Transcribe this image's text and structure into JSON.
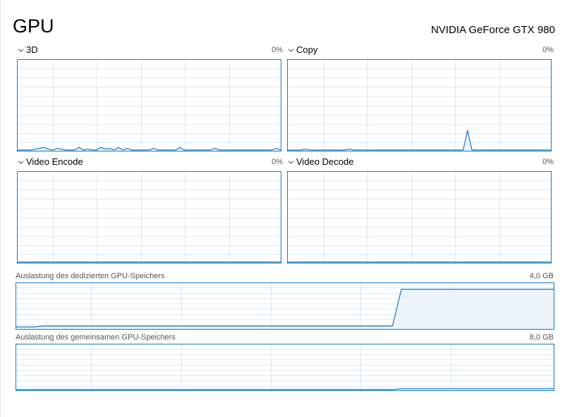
{
  "title": "GPU",
  "gpu_name": "NVIDIA GeForce GTX 980",
  "colors": {
    "graph_border": "#1779ba",
    "graph_line": "#1779ba",
    "grid": "#d9eaf7",
    "fill": "#e8f1fa"
  },
  "engines": [
    {
      "label": "3D",
      "utilization": "0%",
      "expand_icon": "chevron-down-icon",
      "samples": [
        0,
        0,
        0,
        0,
        0.01,
        0.02,
        0.03,
        0.01,
        0,
        0.02,
        0.01,
        0,
        0,
        0,
        0.03,
        0,
        0.01,
        0,
        0,
        0.03,
        0.01,
        0.02,
        0,
        0.03,
        0,
        0.02,
        0,
        0,
        0,
        0,
        0,
        0.02,
        0,
        0,
        0,
        0,
        0,
        0.03,
        0,
        0,
        0,
        0,
        0,
        0,
        0,
        0.02,
        0,
        0,
        0,
        0,
        0,
        0,
        0,
        0,
        0,
        0,
        0,
        0,
        0,
        0.02,
        0
      ]
    },
    {
      "label": "Copy",
      "utilization": "0%",
      "expand_icon": "chevron-down-icon",
      "samples": [
        0,
        0,
        0,
        0,
        0.01,
        0,
        0,
        0,
        0,
        0,
        0,
        0,
        0,
        0,
        0.01,
        0,
        0,
        0,
        0,
        0,
        0,
        0,
        0,
        0,
        0,
        0,
        0,
        0,
        0,
        0,
        0,
        0,
        0,
        0,
        0,
        0,
        0,
        0,
        0,
        0,
        0,
        0.22,
        0,
        0,
        0,
        0,
        0,
        0,
        0,
        0,
        0,
        0,
        0,
        0,
        0,
        0,
        0,
        0,
        0,
        0,
        0
      ]
    },
    {
      "label": "Video Encode",
      "utilization": "0%",
      "expand_icon": "chevron-down-icon",
      "samples": [
        0,
        0,
        0,
        0,
        0,
        0,
        0,
        0,
        0,
        0,
        0,
        0,
        0,
        0,
        0,
        0,
        0,
        0,
        0,
        0,
        0,
        0,
        0,
        0,
        0,
        0,
        0,
        0,
        0,
        0,
        0,
        0,
        0,
        0,
        0,
        0,
        0,
        0,
        0,
        0,
        0,
        0,
        0,
        0,
        0,
        0,
        0,
        0,
        0,
        0,
        0,
        0,
        0,
        0,
        0,
        0,
        0,
        0,
        0,
        0,
        0
      ]
    },
    {
      "label": "Video Decode",
      "utilization": "0%",
      "expand_icon": "chevron-down-icon",
      "samples": [
        0,
        0,
        0,
        0,
        0,
        0,
        0,
        0,
        0,
        0,
        0,
        0,
        0,
        0,
        0,
        0,
        0,
        0,
        0,
        0,
        0,
        0,
        0,
        0,
        0,
        0,
        0,
        0,
        0,
        0,
        0,
        0,
        0,
        0,
        0,
        0,
        0,
        0,
        0,
        0,
        0,
        0,
        0,
        0,
        0,
        0,
        0,
        0,
        0,
        0,
        0,
        0,
        0,
        0,
        0,
        0,
        0,
        0,
        0,
        0,
        0
      ]
    }
  ],
  "memory": [
    {
      "label": "Auslastung des dedizierten GPU-Speichers",
      "capacity": "4,0 GB",
      "samples": [
        0.03,
        0.03,
        0.03,
        0.05,
        0.05,
        0.05,
        0.05,
        0.05,
        0.05,
        0.05,
        0.05,
        0.05,
        0.05,
        0.05,
        0.05,
        0.05,
        0.05,
        0.05,
        0.05,
        0.05,
        0.05,
        0.05,
        0.05,
        0.05,
        0.05,
        0.05,
        0.05,
        0.05,
        0.05,
        0.05,
        0.05,
        0.05,
        0.05,
        0.05,
        0.05,
        0.05,
        0.05,
        0.05,
        0.05,
        0.05,
        0.05,
        0.05,
        0.05,
        0.88,
        0.88,
        0.88,
        0.88,
        0.88,
        0.88,
        0.88,
        0.88,
        0.88,
        0.88,
        0.88,
        0.88,
        0.88,
        0.88,
        0.88,
        0.88,
        0.88,
        0.88
      ]
    },
    {
      "label": "Auslastung des gemeinsamen GPU-Speichers",
      "capacity": "8,0 GB",
      "samples": [
        0,
        0,
        0,
        0,
        0,
        0,
        0,
        0,
        0,
        0,
        0,
        0,
        0,
        0,
        0,
        0,
        0,
        0,
        0,
        0,
        0,
        0,
        0,
        0,
        0,
        0,
        0,
        0,
        0,
        0,
        0,
        0,
        0,
        0,
        0,
        0,
        0,
        0,
        0,
        0,
        0,
        0,
        0,
        0.02,
        0.02,
        0.02,
        0.02,
        0.02,
        0.02,
        0.02,
        0.02,
        0.02,
        0.02,
        0.02,
        0.02,
        0.02,
        0.02,
        0.02,
        0.02,
        0.02,
        0.02
      ]
    }
  ]
}
